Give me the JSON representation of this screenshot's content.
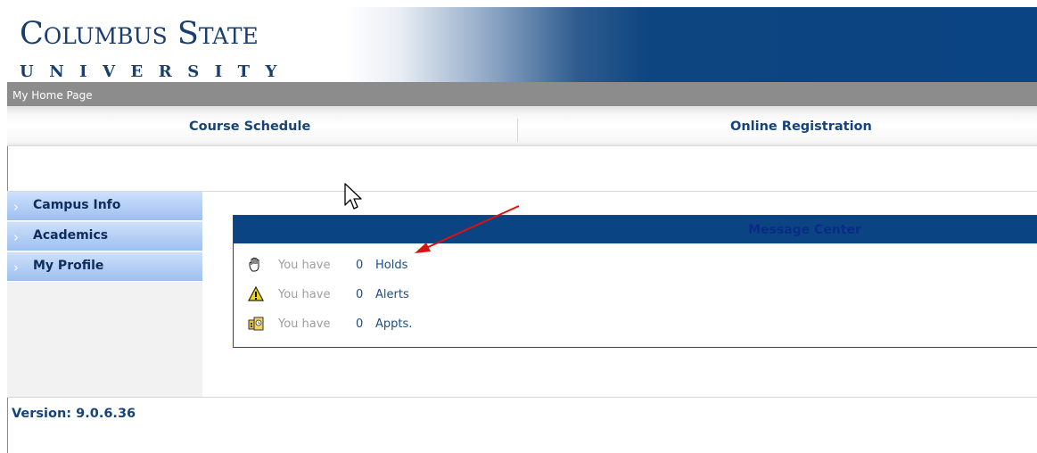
{
  "header": {
    "logo_line1": "Columbus State",
    "logo_line2": "UNIVERSITY",
    "breadcrumb": "My Home Page"
  },
  "topnav": {
    "items": [
      {
        "label": "Course Schedule"
      },
      {
        "label": "Online Registration"
      }
    ]
  },
  "sidebar": {
    "items": [
      {
        "label": "Campus Info"
      },
      {
        "label": "Academics"
      },
      {
        "label": "My Profile"
      }
    ]
  },
  "message_center": {
    "title": "Message Center",
    "rows": [
      {
        "icon": "hand-stop-icon",
        "prefix": "You have",
        "count": "0",
        "link": "Holds"
      },
      {
        "icon": "warning-icon",
        "prefix": "You have",
        "count": "0",
        "link": "Alerts"
      },
      {
        "icon": "appointment-icon",
        "prefix": "You have",
        "count": "0",
        "link": "Appts."
      }
    ]
  },
  "footer": {
    "version": "Version: 9.0.6.36"
  },
  "colors": {
    "brand_blue": "#0b4482",
    "link_blue": "#16437a",
    "sidebar_button": "#b8d1f6",
    "annotation_red": "#e01010"
  }
}
